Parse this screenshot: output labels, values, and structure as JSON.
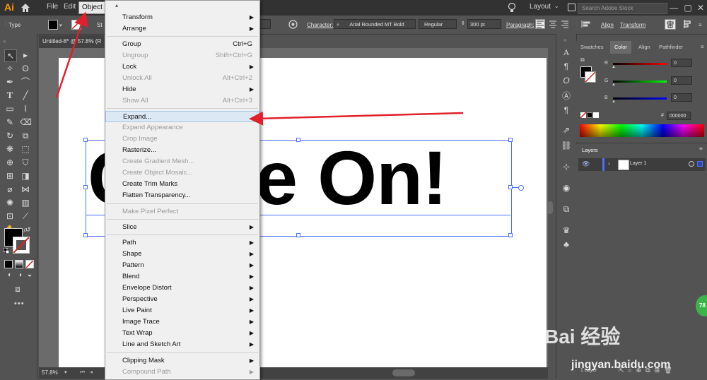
{
  "app": {
    "logo": "Ai"
  },
  "menubar": {
    "items": [
      "File",
      "Edit",
      "Object"
    ],
    "layout_label": "Layout",
    "search_placeholder": "Search Adobe Stock",
    "window_buttons": [
      "—",
      "▢",
      "✕"
    ]
  },
  "controlbar": {
    "type_label": "Type",
    "stroke_abbrev": "St",
    "character_label": "Character:",
    "font_name": "Arial Rounded MT Bold",
    "font_style": "Regular",
    "font_size": "300 pt",
    "paragraph_label": "Paragraph:",
    "align_label": "Align",
    "transform_label": "Transform"
  },
  "document": {
    "tab_title": "Untitled-8* @ 57.8% (R",
    "artwork_text": "Come On!",
    "zoom": "57.8%"
  },
  "object_menu": {
    "groups": [
      [
        {
          "label": "Transform",
          "submenu": true
        },
        {
          "label": "Arrange",
          "submenu": true
        }
      ],
      [
        {
          "label": "Group",
          "shortcut": "Ctrl+G"
        },
        {
          "label": "Ungroup",
          "shortcut": "Shift+Ctrl+G",
          "disabled": true
        },
        {
          "label": "Lock",
          "submenu": true
        },
        {
          "label": "Unlock All",
          "shortcut": "Alt+Ctrl+2",
          "disabled": true
        },
        {
          "label": "Hide",
          "submenu": true
        },
        {
          "label": "Show All",
          "shortcut": "Alt+Ctrl+3",
          "disabled": true
        }
      ],
      [
        {
          "label": "Expand...",
          "highlighted": true
        },
        {
          "label": "Expand Appearance",
          "disabled": true
        },
        {
          "label": "Crop Image",
          "disabled": true
        },
        {
          "label": "Rasterize..."
        },
        {
          "label": "Create Gradient Mesh...",
          "disabled": true
        },
        {
          "label": "Create Object Mosaic...",
          "disabled": true
        },
        {
          "label": "Create Trim Marks"
        },
        {
          "label": "Flatten Transparency..."
        }
      ],
      [
        {
          "label": "Make Pixel Perfect",
          "disabled": true
        }
      ],
      [
        {
          "label": "Slice",
          "submenu": true
        }
      ],
      [
        {
          "label": "Path",
          "submenu": true
        },
        {
          "label": "Shape",
          "submenu": true
        },
        {
          "label": "Pattern",
          "submenu": true
        },
        {
          "label": "Blend",
          "submenu": true
        },
        {
          "label": "Envelope Distort",
          "submenu": true
        },
        {
          "label": "Perspective",
          "submenu": true
        },
        {
          "label": "Live Paint",
          "submenu": true
        },
        {
          "label": "Image Trace",
          "submenu": true
        },
        {
          "label": "Text Wrap",
          "submenu": true
        },
        {
          "label": "Line and Sketch Art",
          "submenu": true
        }
      ],
      [
        {
          "label": "Clipping Mask",
          "submenu": true
        },
        {
          "label": "Compound Path",
          "submenu": true,
          "disabled": true
        }
      ]
    ]
  },
  "color_panel": {
    "tabs": [
      "Swatches",
      "Color",
      "Align",
      "Pathfinder"
    ],
    "active_tab": "Color",
    "channels": [
      {
        "label": "R",
        "value": "0",
        "color": "#ff3333"
      },
      {
        "label": "G",
        "value": "0",
        "color": "#33dd33"
      },
      {
        "label": "B",
        "value": "0",
        "color": "#3355ff"
      }
    ],
    "hex_label": "#",
    "hex_value": "000000"
  },
  "layers_panel": {
    "title": "Layers",
    "layer_name": "Layer 1",
    "footer_count": "1 Layer"
  },
  "watermark": {
    "brand": "Bai  经验",
    "url": "jingyan.baidu.com",
    "badge": "78"
  },
  "colors": {
    "accent_selection": "#4a6eff",
    "annotation_arrow": "#e0202a",
    "menu_highlight": "#dde8f5"
  }
}
